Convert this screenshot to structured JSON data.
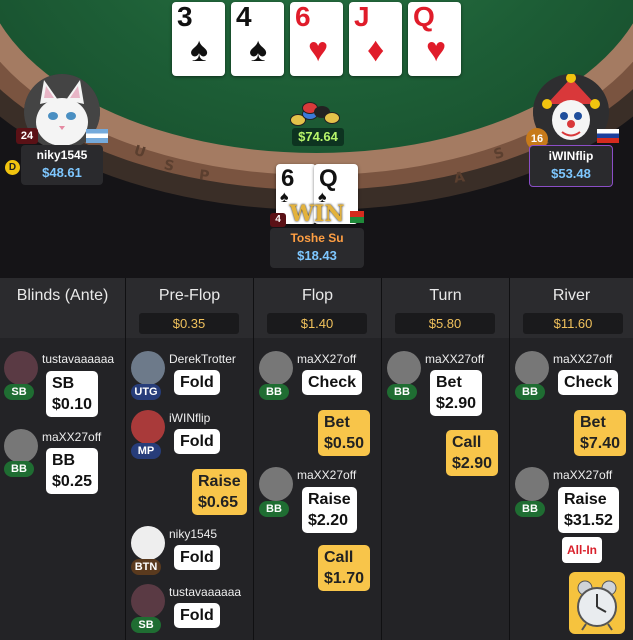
{
  "board": {
    "cards": [
      {
        "rank": "3",
        "suit": "♠",
        "color": "#111111"
      },
      {
        "rank": "4",
        "suit": "♠",
        "color": "#111111"
      },
      {
        "rank": "6",
        "suit": "♥",
        "color": "#e01c2a"
      },
      {
        "rank": "J",
        "suit": "♦",
        "color": "#e01c2a"
      },
      {
        "rank": "Q",
        "suit": "♥",
        "color": "#e01c2a"
      }
    ],
    "pot": "$74.64"
  },
  "rail_letters": [
    "U",
    "S",
    "P",
    "A",
    "S"
  ],
  "seats": {
    "left": {
      "name": "niky1545",
      "stack": "$48.61",
      "level": "24",
      "dealer": "D"
    },
    "right": {
      "name": "iWINflip",
      "stack": "$53.48",
      "level": "16"
    },
    "hero": {
      "name": "Toshe Su",
      "stack": "$18.43",
      "level": "4",
      "cards": [
        {
          "rank": "6",
          "suit": "♠"
        },
        {
          "rank": "Q",
          "suit": "♠"
        }
      ],
      "win_label": "WIN"
    }
  },
  "history": {
    "columns": [
      {
        "title": "Blinds (Ante)",
        "pot": ""
      },
      {
        "title": "Pre-Flop",
        "pot": "$0.35"
      },
      {
        "title": "Flop",
        "pot": "$1.40"
      },
      {
        "title": "Turn",
        "pot": "$5.80"
      },
      {
        "title": "River",
        "pot": "$11.60"
      }
    ],
    "blinds": [
      {
        "name": "tustavaaaaaa",
        "pos": "SB",
        "action": "SB",
        "amount": "$0.10"
      },
      {
        "name": "maXX27off",
        "pos": "BB",
        "action": "BB",
        "amount": "$0.25"
      }
    ],
    "preflop": [
      {
        "name": "DerekTrotter",
        "pos": "UTG",
        "action": "Fold"
      },
      {
        "name": "iWINflip",
        "pos": "MP",
        "action": "Fold"
      },
      {
        "action": "Raise",
        "amount": "$0.65"
      },
      {
        "name": "niky1545",
        "pos": "BTN",
        "action": "Fold"
      },
      {
        "name": "tustavaaaaaa",
        "pos": "SB",
        "action": "Fold"
      }
    ],
    "flop": [
      {
        "name": "maXX27off",
        "pos": "BB",
        "action": "Check"
      },
      {
        "action": "Bet",
        "amount": "$0.50"
      },
      {
        "name": "maXX27off",
        "pos": "BB",
        "action": "Raise",
        "amount": "$2.20"
      },
      {
        "action": "Call",
        "amount": "$1.70"
      }
    ],
    "turn": [
      {
        "name": "maXX27off",
        "pos": "BB",
        "action": "Bet",
        "amount": "$2.90"
      },
      {
        "action": "Call",
        "amount": "$2.90"
      }
    ],
    "river": [
      {
        "name": "maXX27off",
        "pos": "BB",
        "action": "Check"
      },
      {
        "action": "Bet",
        "amount": "$7.40"
      },
      {
        "name": "maXX27off",
        "pos": "BB",
        "action": "Raise",
        "amount": "$31.52"
      },
      {
        "allin": "All-In"
      }
    ]
  }
}
